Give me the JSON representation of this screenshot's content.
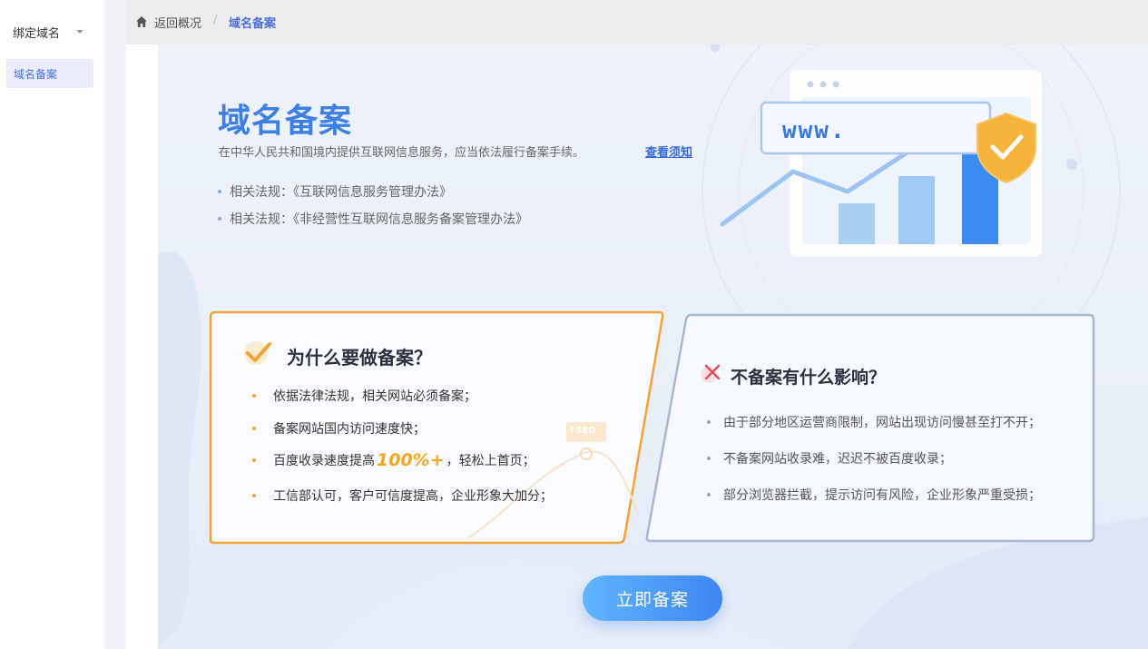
{
  "sidebar": {
    "group_label": "绑定域名",
    "items": [
      {
        "label": "域名备案",
        "active": true
      }
    ]
  },
  "breadcrumb": {
    "back_label": "返回概况",
    "separator": "/",
    "current_label": "域名备案"
  },
  "hero": {
    "title": "域名备案",
    "description": "在中华人民共和国境内提供互联网信息服务，应当依法履行备案手续。",
    "link_label": "查看须知",
    "laws": [
      "相关法规：《互联网信息服务管理办法》",
      "相关法规：《非经营性互联网信息服务备案管理办法》"
    ],
    "illustration_text": "www.",
    "seo_badge": "↑SEO"
  },
  "why_card": {
    "title": "为什么要做备案？",
    "items": [
      {
        "text": "依据法律法规，相关网站必须备案；"
      },
      {
        "text": "备案网站国内访问速度快；"
      },
      {
        "prefix": "百度收录速度提高",
        "highlight": "100%+",
        "suffix": "，轻松上首页；"
      },
      {
        "text": "工信部认可，客户可信度提高，企业形象大加分；"
      }
    ]
  },
  "no_card": {
    "title": "不备案有什么影响？",
    "items": [
      "由于部分地区运营商限制，网站出现访问慢甚至打不开；",
      "不备案网站收录难，迟迟不被百度收录；",
      "部分浏览器拦截，提示访问有风险，企业形象严重受损；"
    ]
  },
  "cta": {
    "label": "立即备案"
  },
  "colors": {
    "accent": "#3d7fe6",
    "orange": "#f3a23a",
    "active_bg": "#e8ecfb"
  },
  "icons": [
    "chevron-down-icon",
    "home-icon",
    "check-icon",
    "close-icon",
    "shield-check-icon"
  ]
}
